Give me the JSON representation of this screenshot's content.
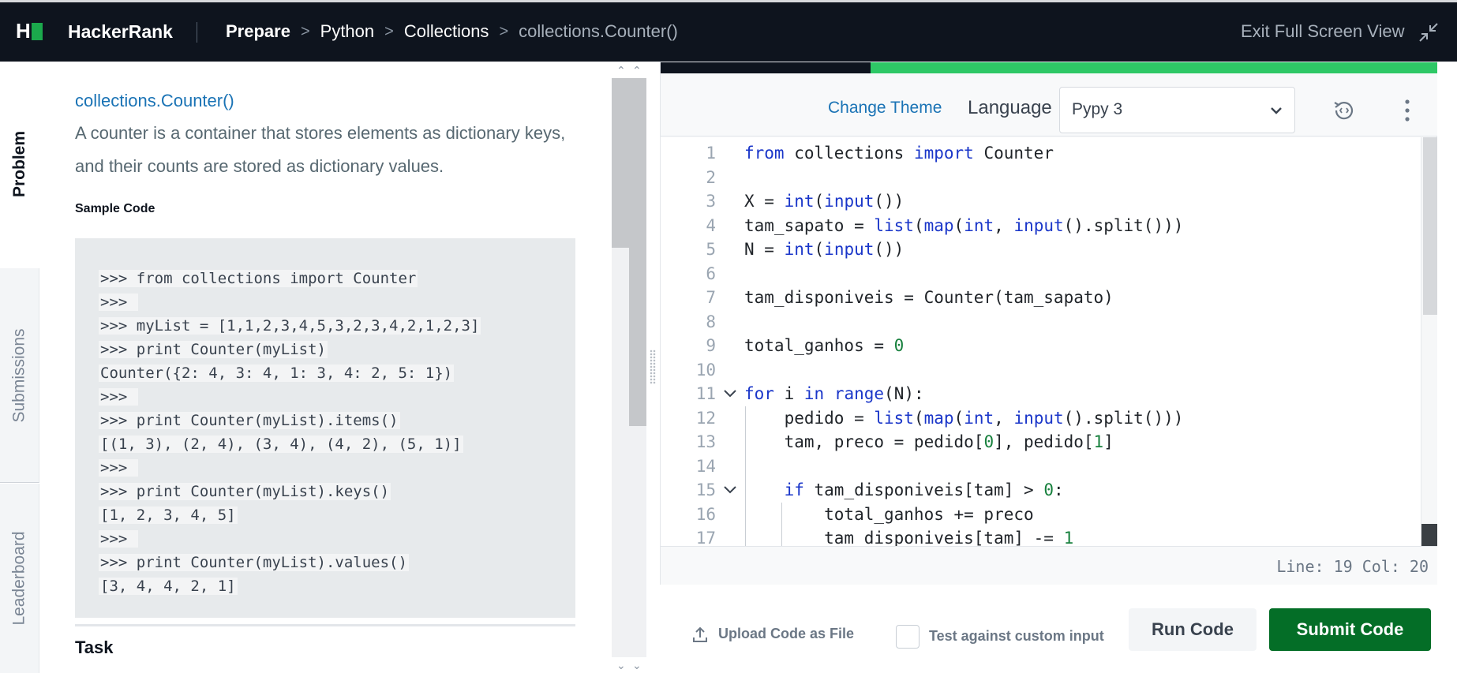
{
  "topbar": {
    "brand": "HackerRank",
    "breadcrumbs": {
      "prepare": "Prepare",
      "python": "Python",
      "collections": "Collections",
      "current": "collections.Counter()"
    },
    "exit_fullscreen": "Exit Full Screen View"
  },
  "side_tabs": {
    "problem": "Problem",
    "submissions": "Submissions",
    "leaderboard": "Leaderboard"
  },
  "problem": {
    "link": "collections.Counter()",
    "description": "A counter is a container that stores elements as dictionary keys, and their counts are stored as dictionary values.",
    "sample_heading": "Sample Code",
    "sample_code": [
      ">>> from collections import Counter",
      ">>> ",
      ">>> myList = [1,1,2,3,4,5,3,2,3,4,2,1,2,3]",
      ">>> print Counter(myList)",
      "Counter({2: 4, 3: 4, 1: 3, 4: 2, 5: 1})",
      ">>> ",
      ">>> print Counter(myList).items()",
      "[(1, 3), (2, 4), (3, 4), (4, 2), (5, 1)]",
      ">>> ",
      ">>> print Counter(myList).keys()",
      "[1, 2, 3, 4, 5]",
      ">>> ",
      ">>> print Counter(myList).values()",
      "[3, 4, 4, 2, 1]"
    ],
    "task_heading": "Task"
  },
  "editor": {
    "change_theme": "Change Theme",
    "language_label": "Language",
    "language_value": "Pypy 3",
    "status": "Line: 19 Col: 20",
    "lines": [
      {
        "n": "1",
        "tokens": [
          [
            "kw",
            "from"
          ],
          [
            "t",
            " collections "
          ],
          [
            "kw",
            "import"
          ],
          [
            "t",
            " Counter"
          ]
        ]
      },
      {
        "n": "2",
        "tokens": []
      },
      {
        "n": "3",
        "tokens": [
          [
            "t",
            "X = "
          ],
          [
            "fn",
            "int"
          ],
          [
            "t",
            "("
          ],
          [
            "fn",
            "input"
          ],
          [
            "t",
            "())"
          ]
        ]
      },
      {
        "n": "4",
        "tokens": [
          [
            "t",
            "tam_sapato = "
          ],
          [
            "fn",
            "list"
          ],
          [
            "t",
            "("
          ],
          [
            "fn",
            "map"
          ],
          [
            "t",
            "("
          ],
          [
            "fn",
            "int"
          ],
          [
            "t",
            ", "
          ],
          [
            "fn",
            "input"
          ],
          [
            "t",
            "().split()))"
          ]
        ]
      },
      {
        "n": "5",
        "tokens": [
          [
            "t",
            "N = "
          ],
          [
            "fn",
            "int"
          ],
          [
            "t",
            "("
          ],
          [
            "fn",
            "input"
          ],
          [
            "t",
            "())"
          ]
        ]
      },
      {
        "n": "6",
        "tokens": []
      },
      {
        "n": "7",
        "tokens": [
          [
            "t",
            "tam_disponiveis = Counter(tam_sapato)"
          ]
        ]
      },
      {
        "n": "8",
        "tokens": []
      },
      {
        "n": "9",
        "tokens": [
          [
            "t",
            "total_ganhos = "
          ],
          [
            "num",
            "0"
          ]
        ]
      },
      {
        "n": "10",
        "tokens": []
      },
      {
        "n": "11",
        "fold": true,
        "tokens": [
          [
            "kw",
            "for"
          ],
          [
            "t",
            " i "
          ],
          [
            "kw",
            "in"
          ],
          [
            "t",
            " "
          ],
          [
            "fn",
            "range"
          ],
          [
            "t",
            "(N):"
          ]
        ]
      },
      {
        "n": "12",
        "tokens": [
          [
            "t",
            "    pedido = "
          ],
          [
            "fn",
            "list"
          ],
          [
            "t",
            "("
          ],
          [
            "fn",
            "map"
          ],
          [
            "t",
            "("
          ],
          [
            "fn",
            "int"
          ],
          [
            "t",
            ", "
          ],
          [
            "fn",
            "input"
          ],
          [
            "t",
            "().split()))"
          ]
        ]
      },
      {
        "n": "13",
        "tokens": [
          [
            "t",
            "    tam, preco = pedido["
          ],
          [
            "num",
            "0"
          ],
          [
            "t",
            "], pedido["
          ],
          [
            "num",
            "1"
          ],
          [
            "t",
            "]"
          ]
        ]
      },
      {
        "n": "14",
        "tokens": []
      },
      {
        "n": "15",
        "fold": true,
        "tokens": [
          [
            "t",
            "    "
          ],
          [
            "kw",
            "if"
          ],
          [
            "t",
            " tam_disponiveis[tam] > "
          ],
          [
            "num",
            "0"
          ],
          [
            "t",
            ":"
          ]
        ]
      },
      {
        "n": "16",
        "tokens": [
          [
            "t",
            "        total_ganhos += preco"
          ]
        ]
      },
      {
        "n": "17",
        "tokens": [
          [
            "t",
            "        tam_disponiveis[tam] -= "
          ],
          [
            "num",
            "1"
          ]
        ]
      }
    ],
    "progress_fraction": 0.73
  },
  "actions": {
    "upload": "Upload Code as File",
    "custom_input": "Test against custom input",
    "run": "Run Code",
    "submit": "Submit Code"
  },
  "colors": {
    "topbar_bg": "#0e141e",
    "brand_green": "#1ba94c",
    "progress_green": "#2ec866",
    "submit_green": "#046e27",
    "link_blue": "#1a73b5",
    "keyword_blue": "#1a36c9",
    "number_green": "#17803d"
  },
  "icons": {
    "logo": "hackerrank-logo-icon",
    "breadcrumb_separator": "chevron-right-icon",
    "exit_fullscreen": "shrink-arrows-icon",
    "language_dropdown": "chevron-down-icon",
    "history": "history-icon",
    "more": "kebab-menu-icon",
    "upload": "upload-icon",
    "fold": "fold-chevron-icon"
  }
}
